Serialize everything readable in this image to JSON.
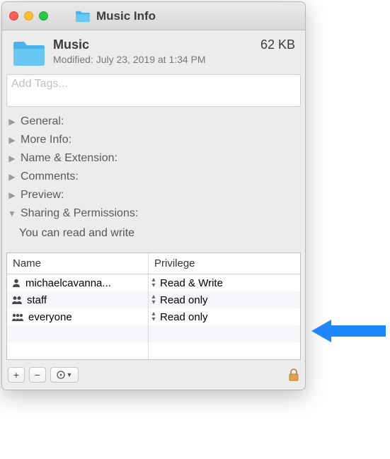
{
  "window": {
    "title": "Music Info"
  },
  "header": {
    "name": "Music",
    "size": "62 KB",
    "modified_label": "Modified:",
    "modified_value": "July 23, 2019 at 1:34 PM"
  },
  "tags": {
    "placeholder": "Add Tags..."
  },
  "sections": {
    "general": "General:",
    "more_info": "More Info:",
    "name_ext": "Name & Extension:",
    "comments": "Comments:",
    "preview": "Preview:",
    "sharing": "Sharing & Permissions:"
  },
  "permissions": {
    "hint": "You can read and write",
    "columns": {
      "name": "Name",
      "privilege": "Privilege"
    },
    "rows": [
      {
        "name": "michaelcavanna...",
        "privilege": "Read & Write",
        "icon": "single"
      },
      {
        "name": "staff",
        "privilege": "Read only",
        "icon": "double"
      },
      {
        "name": "everyone",
        "privilege": "Read only",
        "icon": "triple"
      }
    ]
  },
  "toolbar": {
    "add": "+",
    "remove": "−",
    "action": "⊙"
  }
}
